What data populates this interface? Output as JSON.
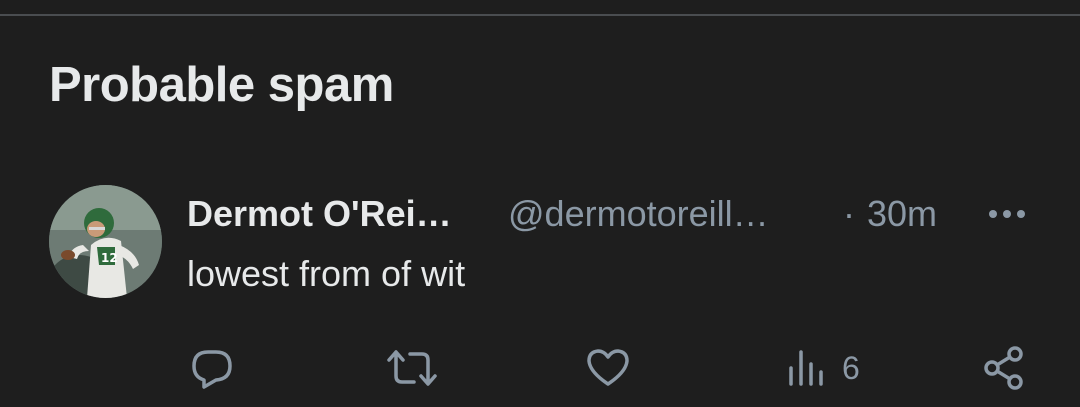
{
  "section": {
    "title": "Probable spam"
  },
  "tweet": {
    "author_name": "Dermot O'Rei…",
    "author_handle": "@dermotoreill…",
    "separator": "·",
    "time": "30m",
    "text": "lowest from of wit",
    "actions": {
      "reply_icon": "reply-icon",
      "retweet_icon": "retweet-icon",
      "like_icon": "heart-icon",
      "views_icon": "views-bar-chart-icon",
      "views_count": "6",
      "share_icon": "share-icon"
    }
  },
  "colors": {
    "background": "#1e1e1e",
    "primary_text": "#e7e9ea",
    "secondary_text": "#8b98a5",
    "divider": "#4a4d50"
  }
}
